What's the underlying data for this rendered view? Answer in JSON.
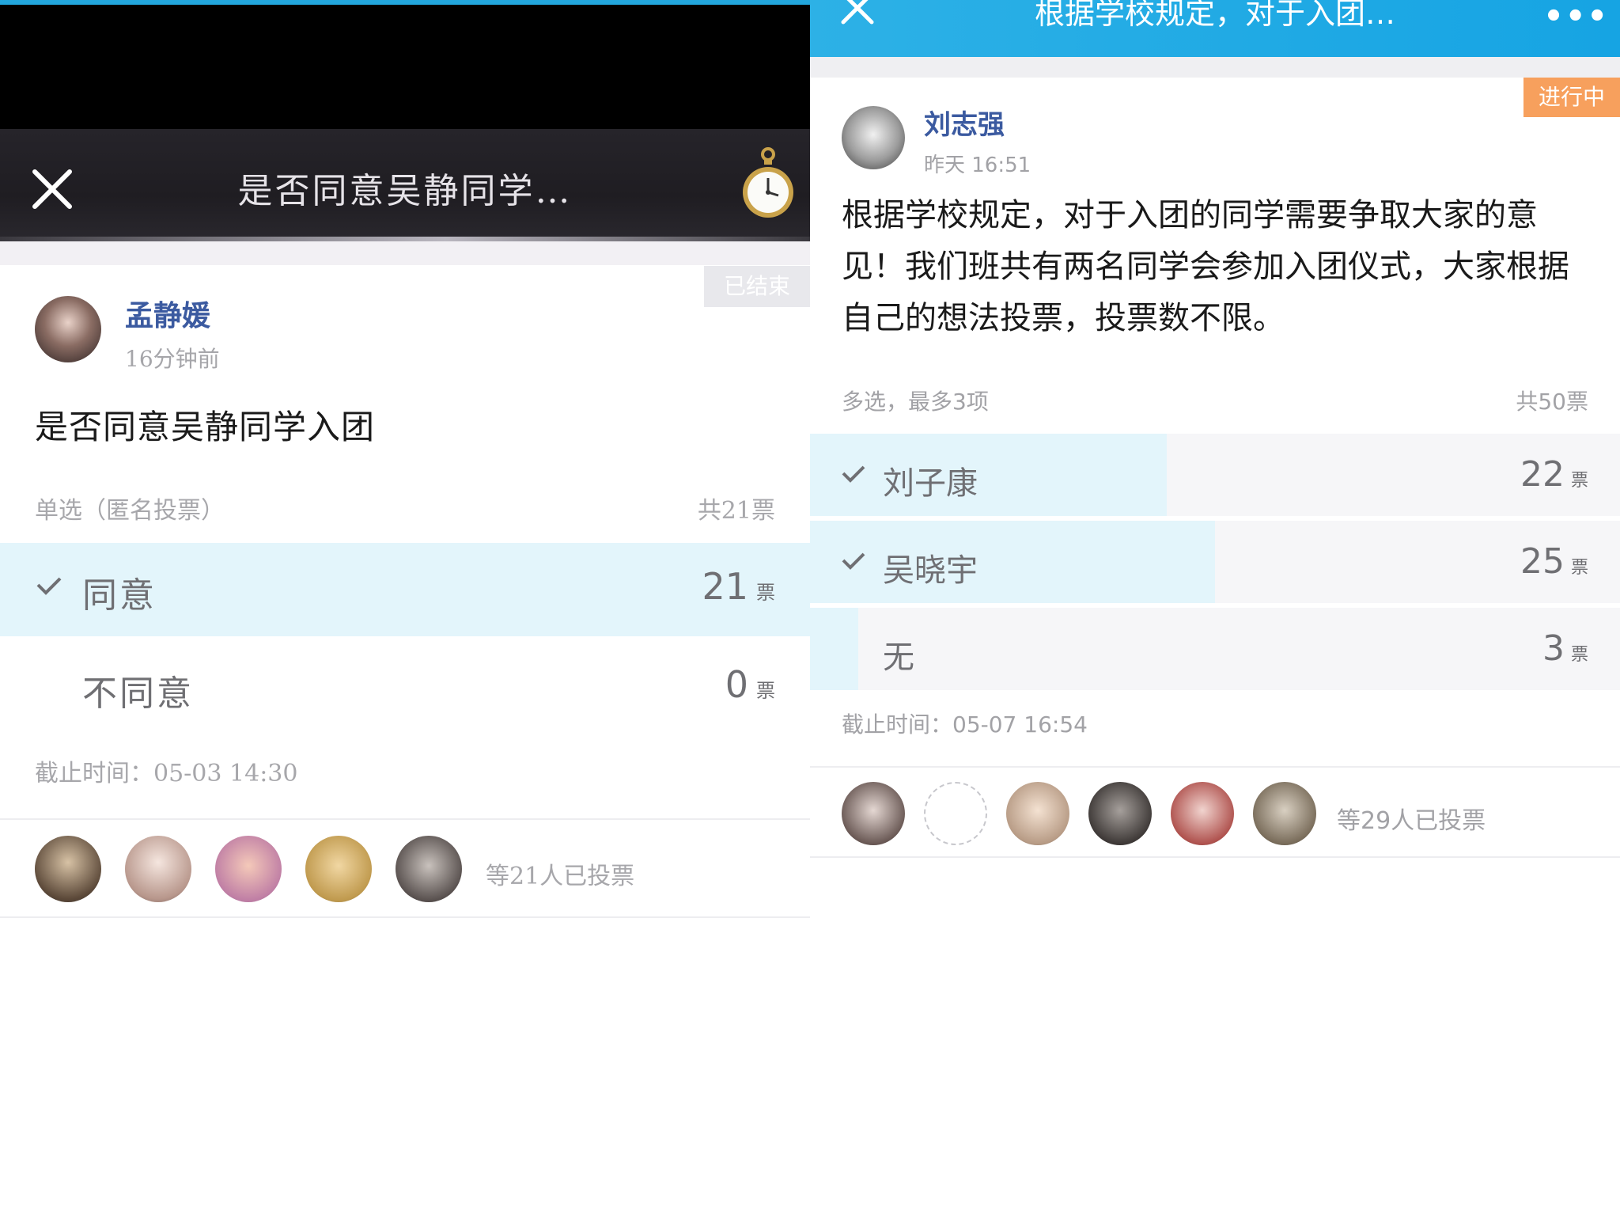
{
  "left": {
    "header": {
      "title": "是否同意吴静同学…",
      "close_icon": "close-icon",
      "watch_icon": "pocket-watch-icon"
    },
    "post": {
      "status_badge": "已结束",
      "author": "孟静媛",
      "time": "16分钟前",
      "question": "是否同意吴静同学入团"
    },
    "poll": {
      "mode": "单选（匿名投票）",
      "total": "共21票",
      "unit": "票",
      "options": [
        {
          "label": "同意",
          "count": "21",
          "selected": true,
          "share": 1.0
        },
        {
          "label": "不同意",
          "count": "0",
          "selected": false,
          "share": 0.0
        }
      ],
      "deadline": "截止时间：05-03 14:30"
    },
    "voters": {
      "summary": "等21人已投票",
      "avatar_count": 5
    }
  },
  "right": {
    "header": {
      "title": "根据学校规定，对于入团…",
      "close_icon": "close-icon",
      "more_icon": "more-dots-icon",
      "more_glyph": "•••"
    },
    "post": {
      "status_badge": "进行中",
      "author": "刘志强",
      "time": "昨天 16:51",
      "body": "根据学校规定，对于入团的同学需要争取大家的意见！我们班共有两名同学会参加入团仪式，大家根据自己的想法投票，投票数不限。"
    },
    "poll": {
      "mode": "多选，最多3项",
      "total": "共50票",
      "unit": "票",
      "options": [
        {
          "label": "刘子康",
          "count": "22",
          "selected": true,
          "share": 0.44
        },
        {
          "label": "吴晓宇",
          "count": "25",
          "selected": true,
          "share": 0.5
        },
        {
          "label": "无",
          "count": "3",
          "selected": false,
          "share": 0.06
        }
      ],
      "deadline": "截止时间：05-07 16:54"
    },
    "voters": {
      "summary": "等29人已投票",
      "avatar_count": 6
    }
  },
  "colors": {
    "accent_blue": "#16a4e3",
    "vote_fill": "#e3f5fb",
    "badge_ended": "#e8e8ec",
    "badge_active": "#f7a05d",
    "author_name": "#3b5aa0"
  }
}
